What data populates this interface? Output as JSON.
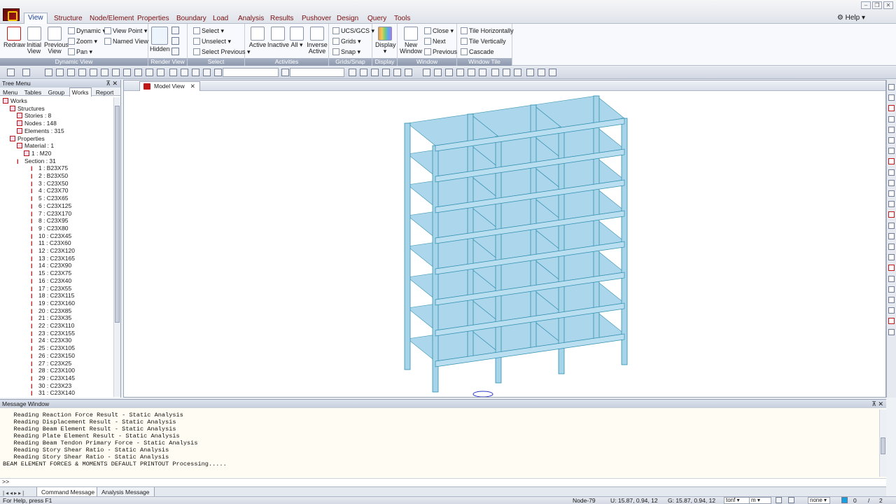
{
  "menubar": {
    "tabs": [
      "View",
      "Structure",
      "Node/Element",
      "Properties",
      "Boundary",
      "Load",
      "Analysis",
      "Results",
      "Pushover",
      "Design",
      "Query",
      "Tools"
    ],
    "active_tab": "View",
    "help": "Help"
  },
  "ribbon": {
    "dynamic_view": {
      "label": "Dynamic View",
      "redraw": "Redraw",
      "initial_view": "Initial View",
      "previous_view": "Previous View",
      "dynamic": "Dynamic",
      "zoom": "Zoom",
      "pan": "Pan",
      "view_point": "View Point",
      "named_view": "Named View"
    },
    "render_view": {
      "label": "Render View",
      "hidden": "Hidden"
    },
    "select": {
      "label": "Select",
      "select": "Select",
      "unselect": "Unselect",
      "select_previous": "Select Previous"
    },
    "activities": {
      "label": "Activities",
      "active": "Active",
      "inactive": "Inactive",
      "all": "All",
      "inverse_active": "Inverse Active"
    },
    "grids_snap": {
      "label": "Grids/Snap",
      "ucs": "UCS/GCS",
      "grids": "Grids",
      "snap": "Snap"
    },
    "display": {
      "label": "Display",
      "display": "Display"
    },
    "window": {
      "label": "Window",
      "new_window": "New Window",
      "close": "Close",
      "next": "Next",
      "previous": "Previous"
    },
    "window_tile": {
      "label": "Window Tile",
      "tile_h": "Tile Horizontally",
      "tile_v": "Tile Vertically",
      "cascade": "Cascade"
    }
  },
  "tree": {
    "title": "Tree Menu",
    "tabs": [
      "Menu",
      "Tables",
      "Group",
      "Works",
      "Report"
    ],
    "active_tab": "Works",
    "items": [
      {
        "text": "Works",
        "level": 0
      },
      {
        "text": "Structures",
        "level": 1
      },
      {
        "text": "Stories : 8",
        "level": 2
      },
      {
        "text": "Nodes : 148",
        "level": 2
      },
      {
        "text": "Elements : 315",
        "level": 2
      },
      {
        "text": "Properties",
        "level": 1
      },
      {
        "text": "Material : 1",
        "level": 2
      },
      {
        "text": "1 : M20",
        "level": 3
      },
      {
        "text": "Section : 31",
        "level": 2
      },
      {
        "text": "1 : B23X75",
        "level": 3
      },
      {
        "text": "2 : B23X50",
        "level": 3
      },
      {
        "text": "3 : C23X50",
        "level": 3
      },
      {
        "text": "4 : C23X70",
        "level": 3
      },
      {
        "text": "5 : C23X65",
        "level": 3
      },
      {
        "text": "6 : C23X125",
        "level": 3
      },
      {
        "text": "7 : C23X170",
        "level": 3
      },
      {
        "text": "8 : C23X95",
        "level": 3
      },
      {
        "text": "9 : C23X80",
        "level": 3
      },
      {
        "text": "10 : C23X45",
        "level": 3
      },
      {
        "text": "11 : C23X60",
        "level": 3
      },
      {
        "text": "12 : C23X120",
        "level": 3
      },
      {
        "text": "13 : C23X165",
        "level": 3
      },
      {
        "text": "14 : C23X90",
        "level": 3
      },
      {
        "text": "15 : C23X75",
        "level": 3
      },
      {
        "text": "16 : C23X40",
        "level": 3
      },
      {
        "text": "17 : C23X55",
        "level": 3
      },
      {
        "text": "18 : C23X115",
        "level": 3
      },
      {
        "text": "19 : C23X160",
        "level": 3
      },
      {
        "text": "20 : C23X85",
        "level": 3
      },
      {
        "text": "21 : C23X35",
        "level": 3
      },
      {
        "text": "22 : C23X110",
        "level": 3
      },
      {
        "text": "23 : C23X155",
        "level": 3
      },
      {
        "text": "24 : C23X30",
        "level": 3
      },
      {
        "text": "25 : C23X105",
        "level": 3
      },
      {
        "text": "26 : C23X150",
        "level": 3
      },
      {
        "text": "27 : C23X25",
        "level": 3
      },
      {
        "text": "28 : C23X100",
        "level": 3
      },
      {
        "text": "29 : C23X145",
        "level": 3
      },
      {
        "text": "30 : C23X23",
        "level": 3
      },
      {
        "text": "31 : C23X140",
        "level": 3
      }
    ]
  },
  "viewport": {
    "tab": "Model View",
    "model_stories": 8,
    "color": "#a8d4ea"
  },
  "message_window": {
    "title": "Message Window",
    "lines": [
      "   Reading Reaction Force Result - Static Analysis",
      "   Reading Displacement Result - Static Analysis",
      "   Reading Beam Element Result - Static Analysis",
      "   Reading Plate Element Result - Static Analysis",
      "   Reading Beam Tendon Primary Force - Static Analysis",
      "   Reading Story Shear Ratio - Static Analysis",
      "   Reading Story Shear Ratio - Static Analysis",
      "BEAM ELEMENT FORCES & MOMENTS DEFAULT PRINTOUT Processing....."
    ],
    "prompt": ">>",
    "tabs": [
      "Command Message",
      "Analysis Message"
    ],
    "active_tab": "Command Message"
  },
  "statusbar": {
    "help": "For Help, press F1",
    "node": "Node-79",
    "ucs": "U: 15.87, 0.94, 12",
    "gcs": "G: 15.87, 0.94, 12",
    "force_unit": "tonf",
    "length_unit": "m",
    "filter": "none",
    "page_current": "0",
    "page_total": "2"
  }
}
